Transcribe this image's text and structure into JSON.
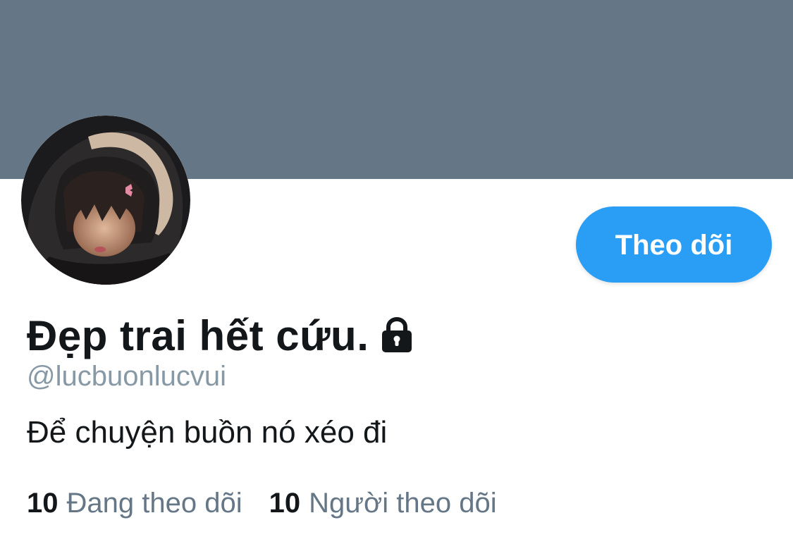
{
  "profile": {
    "display_name": "Đẹp trai hết cứu.",
    "handle": "@lucbuonlucvui",
    "bio": "Để chuyện buồn nó xéo đi",
    "protected_icon": "lock-icon",
    "avatar_icon": "profile-photo"
  },
  "actions": {
    "follow_label": "Theo dõi"
  },
  "stats": {
    "following_count": "10",
    "following_label": "Đang theo dõi",
    "followers_count": "10",
    "followers_label": "Người theo dõi"
  },
  "colors": {
    "banner": "#657786",
    "accent": "#2a9df4",
    "text_primary": "#14171a",
    "text_secondary": "#657786"
  }
}
